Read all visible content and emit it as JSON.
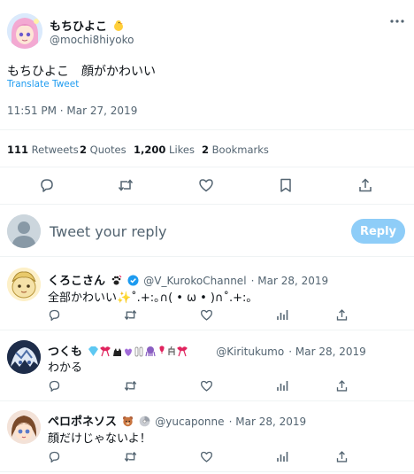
{
  "tweet": {
    "author_name": "もちひよこ",
    "author_handle": "@mochi8hiyoko",
    "text": "もちひよこ　顔がかわいい",
    "translate": "Translate Tweet",
    "timestamp": "11:51 PM · Mar 27, 2019",
    "stats": [
      {
        "count": "111",
        "label": "Retweets"
      },
      {
        "count": "2",
        "label": "Quotes"
      },
      {
        "count": "1,200",
        "label": "Likes"
      },
      {
        "count": "2",
        "label": "Bookmarks"
      }
    ],
    "actions": [
      "reply-icon",
      "retweet-icon",
      "like-icon",
      "bookmark-icon",
      "share-icon"
    ],
    "more": "more-icon"
  },
  "composer": {
    "placeholder": "Tweet your reply",
    "button": "Reply"
  },
  "replies": [
    {
      "name": "くろこさん",
      "handle": "@V_KurokoChannel",
      "date": "· Mar 28, 2019",
      "text": "全部かわいい✨˚.+:｡∩( • ω • )∩˚.+:｡",
      "verified": true
    },
    {
      "name": "つくも",
      "handle": "@Kiritukumo",
      "date": "· Mar 28, 2019",
      "text": "わかる",
      "verified": false
    },
    {
      "name": "ペロポネソス",
      "handle": "@yucaponne",
      "date": "· Mar 28, 2019",
      "text": "顔だけじゃないよ！",
      "verified": false
    }
  ],
  "colors": {
    "accent": "#1d9bf0",
    "reply_button": "#8ecdf8",
    "text": "#0f1419",
    "muted": "#536471"
  }
}
